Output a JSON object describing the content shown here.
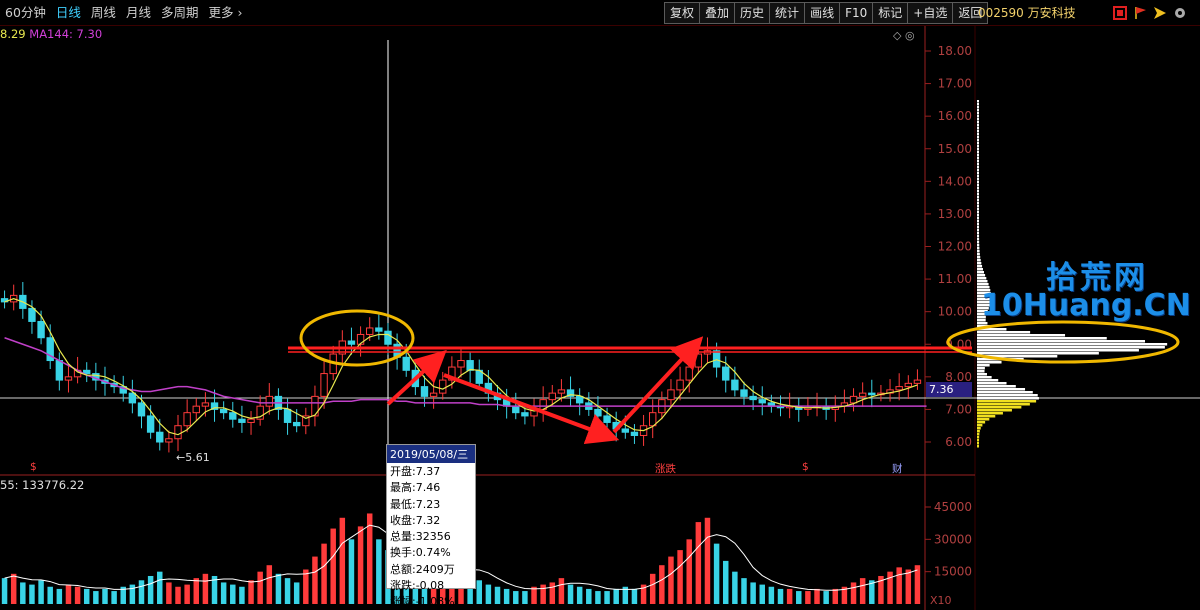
{
  "toolbar": {
    "period_tabs": [
      "60分钟",
      "日线",
      "周线",
      "月线",
      "多周期",
      "更多"
    ],
    "more_arrow": "›",
    "tools": [
      "复权",
      "叠加",
      "历史",
      "统计",
      "画线",
      "F10",
      "标记",
      "+自选",
      "返回"
    ]
  },
  "stock": {
    "code_name": "002590 万安科技"
  },
  "indicators": {
    "ma_short": "8.29",
    "ma_long": "MA144: 7.30",
    "volume": "55: 133776.22",
    "control_glyphs": "◇ ◎"
  },
  "price_axis": {
    "ticks": [
      "18.00",
      "17.00",
      "16.00",
      "15.00",
      "14.00",
      "13.00",
      "12.00",
      "11.00",
      "10.00",
      "9.00",
      "8.00",
      "7.00",
      "6.00"
    ],
    "current_price": "7.36"
  },
  "volume_axis": {
    "ticks": [
      "45000",
      "30000",
      "15000"
    ],
    "unit": "X10"
  },
  "annotations": {
    "low_price": "←5.61",
    "marks": [
      {
        "text": "$",
        "color": "#ff4040"
      },
      {
        "text": "涨跌",
        "color": "#ff4040"
      },
      {
        "text": "$",
        "color": "#ff4040"
      },
      {
        "text": "财",
        "color": "#9aa0ff"
      }
    ]
  },
  "tooltip": {
    "date": "2019/05/08/三",
    "rows": [
      "开盘:7.37",
      "最高:7.46",
      "最低:7.23",
      "收盘:7.32",
      "总量:32356",
      "换手:0.74%",
      "总额:2409万",
      "涨跌:-0.08",
      "涨幅:-1.08%"
    ]
  },
  "watermark": {
    "line1": "拾荒网",
    "line2": "10Huang.CN"
  },
  "colors": {
    "up": "#ff3b3b",
    "down": "#39d3e6",
    "ma_short": "#e9e94f",
    "ma_long": "#c040c8",
    "annotation": "#ff2020",
    "highlight": "#f0b800",
    "axis": "#9a1f1f"
  },
  "chart_data": {
    "type": "candlestick",
    "y_range": [
      5.5,
      18.3
    ],
    "close_series": [
      10.3,
      10.5,
      10.1,
      9.7,
      9.2,
      8.5,
      7.9,
      8.0,
      8.2,
      8.1,
      7.9,
      7.8,
      7.7,
      7.5,
      7.2,
      6.8,
      6.3,
      6.0,
      6.1,
      6.5,
      6.9,
      7.1,
      7.2,
      7.0,
      6.9,
      6.7,
      6.6,
      6.7,
      7.1,
      7.4,
      7.0,
      6.6,
      6.5,
      6.8,
      7.4,
      8.1,
      8.7,
      9.1,
      9.0,
      9.3,
      9.5,
      9.4,
      9.0,
      8.6,
      8.2,
      7.7,
      7.4,
      7.5,
      7.9,
      8.3,
      8.5,
      8.2,
      7.8,
      7.5,
      7.3,
      7.1,
      6.9,
      6.8,
      7.0,
      7.3,
      7.5,
      7.6,
      7.4,
      7.2,
      7.0,
      6.8,
      6.6,
      6.4,
      6.3,
      6.2,
      6.5,
      6.9,
      7.3,
      7.6,
      7.9,
      8.3,
      8.7,
      8.8,
      8.3,
      7.9,
      7.6,
      7.4,
      7.3,
      7.2,
      7.1,
      7.05,
      7.1,
      7.0,
      7.05,
      7.1,
      7.0,
      7.1,
      7.2,
      7.4,
      7.5,
      7.45,
      7.5,
      7.6,
      7.7,
      7.8,
      7.9
    ],
    "volume_series": [
      12,
      14,
      10,
      9,
      11,
      8,
      7,
      9,
      8,
      7,
      6,
      7,
      6,
      8,
      9,
      11,
      13,
      15,
      10,
      8,
      9,
      12,
      14,
      13,
      10,
      9,
      8,
      11,
      15,
      18,
      14,
      12,
      10,
      16,
      22,
      28,
      35,
      40,
      30,
      36,
      42,
      30,
      25,
      18,
      14,
      10,
      9,
      12,
      16,
      20,
      18,
      14,
      11,
      9,
      8,
      7,
      6,
      6,
      8,
      9,
      10,
      12,
      9,
      8,
      7,
      6,
      6,
      7,
      8,
      7,
      9,
      14,
      18,
      22,
      25,
      30,
      38,
      40,
      28,
      20,
      15,
      12,
      10,
      9,
      8,
      7,
      7,
      6,
      6,
      7,
      6,
      7,
      8,
      10,
      12,
      11,
      13,
      15,
      17,
      16,
      18
    ],
    "ma144": [
      9.2,
      9.1,
      9.0,
      8.9,
      8.8,
      8.65,
      8.5,
      8.35,
      8.2,
      8.05,
      7.95,
      7.85,
      7.75,
      7.65,
      7.6,
      7.55,
      7.55,
      7.6,
      7.65,
      7.7,
      7.7,
      7.65,
      7.6,
      7.5,
      7.4,
      7.35,
      7.3,
      7.25,
      7.2,
      7.2,
      7.2,
      7.2,
      7.2,
      7.2,
      7.2,
      7.2,
      7.25,
      7.25,
      7.25,
      7.3,
      7.3,
      7.3,
      7.3,
      7.25,
      7.25,
      7.2,
      7.2,
      7.2,
      7.2,
      7.2,
      7.2,
      7.2,
      7.15,
      7.15,
      7.15,
      7.1,
      7.1,
      7.1,
      7.1,
      7.1,
      7.1,
      7.1,
      7.1,
      7.1,
      7.1,
      7.1,
      7.1,
      7.1,
      7.1,
      7.1,
      7.1,
      7.1,
      7.1,
      7.1,
      7.1,
      7.1,
      7.1,
      7.1,
      7.1,
      7.1,
      7.1,
      7.1,
      7.1,
      7.1,
      7.1,
      7.1,
      7.1,
      7.1,
      7.1,
      7.1,
      7.1,
      7.1,
      7.1,
      7.1,
      7.1,
      7.1,
      7.1,
      7.1,
      7.1,
      7.1,
      7.1,
      7.1
    ],
    "resistance_level": 9.0,
    "current_price": 7.36,
    "low_label_value": 5.61
  }
}
